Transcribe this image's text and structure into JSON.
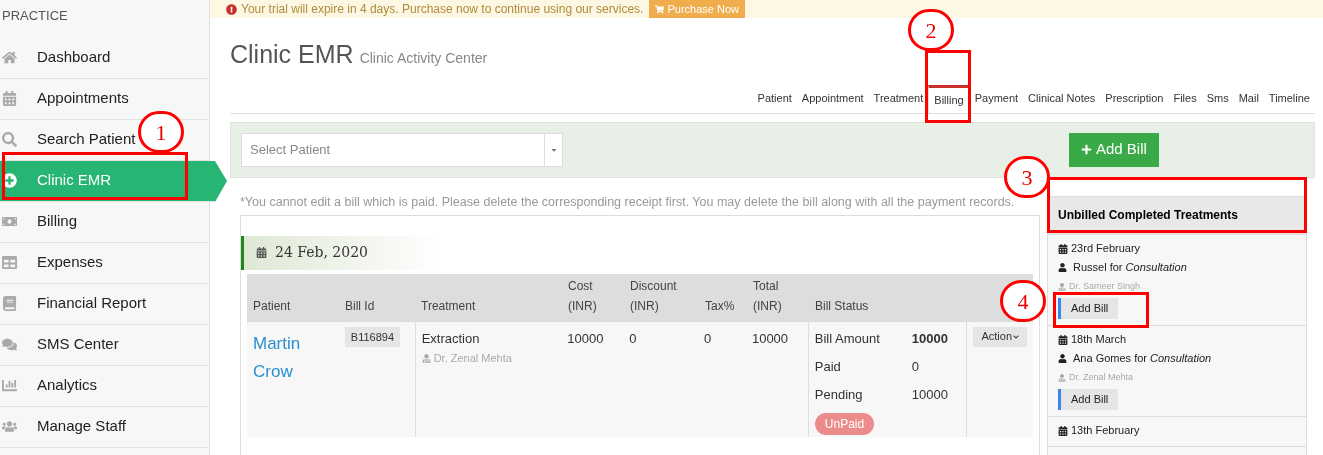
{
  "banner": {
    "message": "Your trial will expire in 4 days. Purchase now to continue using our services.",
    "button": "Purchase Now"
  },
  "sidebar": {
    "heading": "PRACTICE",
    "items": [
      {
        "label": "Dashboard",
        "selected": false
      },
      {
        "label": "Appointments",
        "selected": false
      },
      {
        "label": "Search Patient",
        "selected": false
      },
      {
        "label": "Clinic EMR",
        "selected": true
      },
      {
        "label": "Billing",
        "selected": false
      },
      {
        "label": "Expenses",
        "selected": false
      },
      {
        "label": "Financial Report",
        "selected": false
      },
      {
        "label": "SMS Center",
        "selected": false
      },
      {
        "label": "Analytics",
        "selected": false
      },
      {
        "label": "Manage Staff",
        "selected": false
      }
    ]
  },
  "page": {
    "title": "Clinic EMR",
    "subtitle": "Clinic Activity Center"
  },
  "tabs": [
    {
      "label": "Patient",
      "selected": false
    },
    {
      "label": "Appointment",
      "selected": false
    },
    {
      "label": "Treatment",
      "selected": false
    },
    {
      "label": "Billing",
      "selected": true
    },
    {
      "label": "Payment",
      "selected": false
    },
    {
      "label": "Clinical Notes",
      "selected": false
    },
    {
      "label": "Prescription",
      "selected": false
    },
    {
      "label": "Files",
      "selected": false
    },
    {
      "label": "Sms",
      "selected": false
    },
    {
      "label": "Mail",
      "selected": false
    },
    {
      "label": "Timeline",
      "selected": false
    }
  ],
  "toolbar": {
    "patient_select": {
      "placeholder": "Select Patient"
    },
    "add_bill_button": "Add Bill"
  },
  "note": "*You cannot edit a bill which is paid. Please delete the corresponding receipt first. You may delete the bill along with all the payment records.",
  "bill_group": {
    "date": "24 Feb, 2020",
    "columns": [
      [
        "Patient"
      ],
      [
        "Bill Id"
      ],
      [
        "Treatment"
      ],
      [
        "Cost",
        "(INR)"
      ],
      [
        "Discount",
        "(INR)"
      ],
      [
        "Tax%"
      ],
      [
        "Total",
        "(INR)"
      ],
      [
        "Bill Status"
      ]
    ],
    "rows": [
      {
        "patient": "Martin Crow",
        "bill_id": "B116894",
        "treatment": "Extraction",
        "doctor": "Dr. Zenal Mehta",
        "cost": "10000",
        "discount": "0",
        "tax": "0",
        "total": "10000",
        "status": [
          {
            "label": "Bill Amount",
            "value": "10000"
          },
          {
            "label": "Paid",
            "value": "0"
          },
          {
            "label": "Pending",
            "value": "10000"
          }
        ],
        "badge": "UnPaid",
        "action": "Action"
      }
    ]
  },
  "unbilled": {
    "title": "Unbilled Completed Treatments",
    "items": [
      {
        "date": "23rd February",
        "patient": "Russel",
        "for": "for",
        "treatment": "Consultation",
        "doctor": "Dr. Sameer Singh",
        "button": "Add Bill"
      },
      {
        "date": "18th March",
        "patient": "Ana Gomes",
        "for": "for",
        "treatment": "Consultation",
        "doctor": "Dr. Zenal Mehta",
        "button": "Add Bill"
      },
      {
        "date": "13th February"
      }
    ]
  },
  "annotations": [
    "1",
    "2",
    "3",
    "4"
  ]
}
